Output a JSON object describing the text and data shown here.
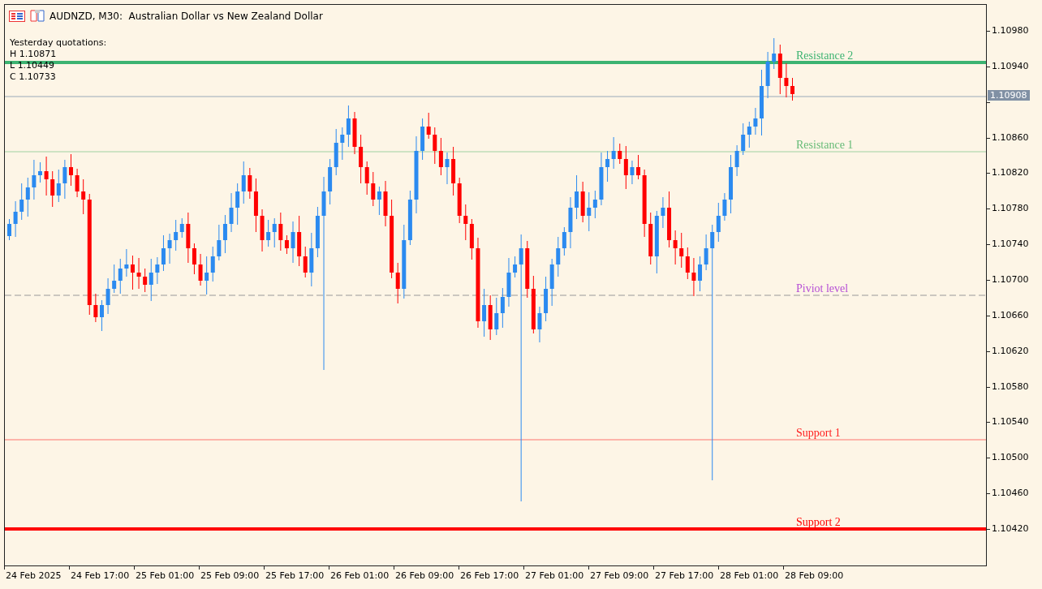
{
  "title": {
    "symbol": "AUDNZD, M30:",
    "description": "Australian Dollar vs New Zealand Dollar"
  },
  "info": {
    "heading": "Yesterday quotations:",
    "lines": [
      "H 1.10871",
      "L 1.10449",
      "C 1.10733"
    ]
  },
  "levels": [
    {
      "label": "Resistance 2",
      "color": "#3cb371",
      "kind": "thick"
    },
    {
      "label": "Resistance 1",
      "color": "#66bb77",
      "kind": "thin"
    },
    {
      "label": "Piviot level",
      "color": "#b64fd6",
      "kind": "dashed"
    },
    {
      "label": "Support 1",
      "color": "#ff2020",
      "kind": "thin"
    },
    {
      "label": "Support 2",
      "color": "#ff0000",
      "kind": "thick"
    }
  ],
  "price_axis": {
    "ticks": [
      "1.10980",
      "1.10940",
      "1.10860",
      "1.10820",
      "1.10780",
      "1.10740",
      "1.10700",
      "1.10660",
      "1.10620",
      "1.10580",
      "1.10540",
      "1.10500",
      "1.10460",
      "1.10420"
    ],
    "current_price": "1.10908"
  },
  "time_axis": [
    "24 Feb 2025",
    "24 Feb 17:00",
    "25 Feb 01:00",
    "25 Feb 09:00",
    "25 Feb 17:00",
    "26 Feb 01:00",
    "26 Feb 09:00",
    "26 Feb 17:00",
    "27 Feb 01:00",
    "27 Feb 09:00",
    "27 Feb 17:00",
    "28 Feb 01:00",
    "28 Feb 09:00"
  ]
}
